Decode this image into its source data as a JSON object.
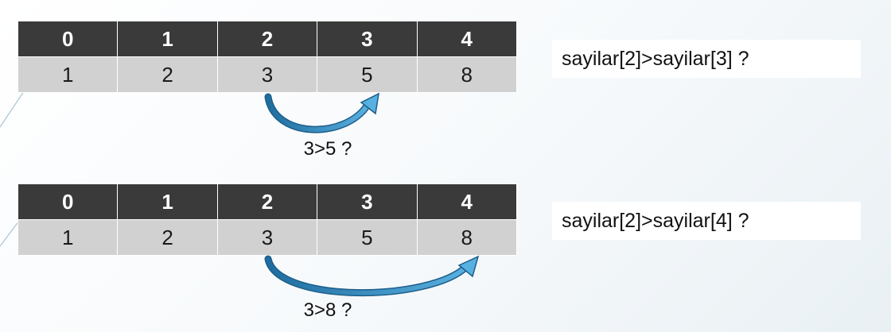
{
  "examples": [
    {
      "indices": [
        "0",
        "1",
        "2",
        "3",
        "4"
      ],
      "values": [
        "1",
        "2",
        "3",
        "5",
        "8"
      ],
      "comparison": "3>5 ?",
      "question": "sayilar[2]>sayilar[3] ?"
    },
    {
      "indices": [
        "0",
        "1",
        "2",
        "3",
        "4"
      ],
      "values": [
        "1",
        "2",
        "3",
        "5",
        "8"
      ],
      "comparison": "3>8 ?",
      "question": "sayilar[2]>sayilar[4] ?"
    }
  ],
  "colors": {
    "header_bg": "#3a3a3a",
    "cell_bg": "#d1d1d1",
    "arrow": "#2e7fb5"
  }
}
